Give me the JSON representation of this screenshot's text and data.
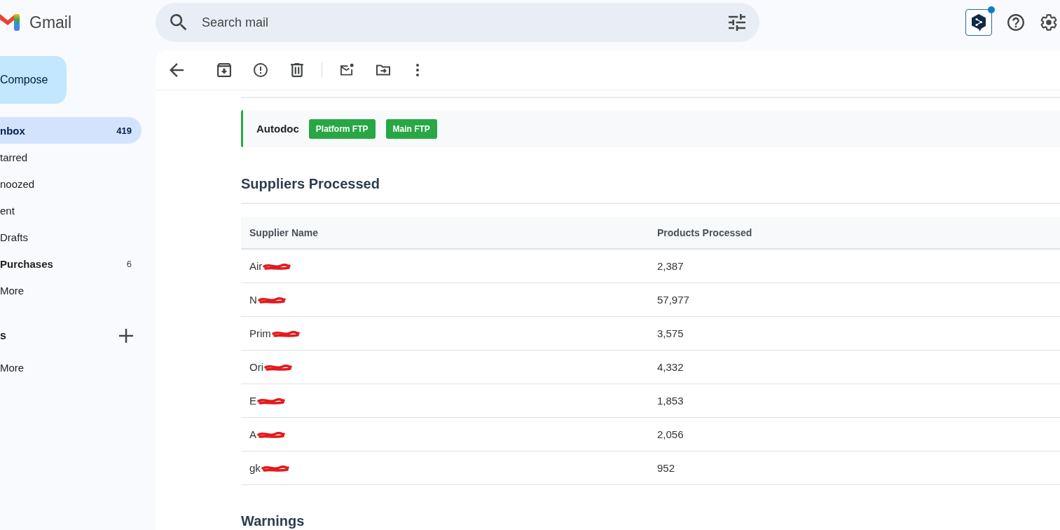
{
  "header": {
    "app_name": "Gmail",
    "search": {
      "placeholder": "Search mail"
    },
    "extension": {
      "notification": true
    }
  },
  "sidebar": {
    "compose": "Compose",
    "items": [
      {
        "label": "nbox",
        "count": "419",
        "unread": true,
        "selected": true
      },
      {
        "label": "tarred",
        "unread": false,
        "selected": false
      },
      {
        "label": "noozed",
        "unread": false,
        "selected": false
      },
      {
        "label": "ent",
        "unread": false,
        "selected": false
      },
      {
        "label": "Drafts",
        "unread": false,
        "selected": false
      },
      {
        "label": "Purchases",
        "count": "6",
        "unread": true,
        "selected": false
      },
      {
        "label": "More",
        "unread": false,
        "selected": false
      }
    ],
    "labels": {
      "title": "s",
      "items": [
        {
          "label": "More",
          "selected": false
        }
      ]
    }
  },
  "message": {
    "source": {
      "name": "Autodoc",
      "tags": [
        "Platform FTP",
        "Main FTP"
      ]
    },
    "sections": [
      {
        "heading": "Suppliers Processed",
        "table": {
          "columns": [
            "Supplier Name",
            "Products Processed"
          ],
          "rows": [
            {
              "supplier": "Air",
              "products": "2,387",
              "redacted": true
            },
            {
              "supplier": "N",
              "products": "57,977",
              "redacted": true
            },
            {
              "supplier": "Prim",
              "products": "3,575",
              "redacted": true
            },
            {
              "supplier": "Ori",
              "products": "4,332",
              "redacted": true
            },
            {
              "supplier": "E",
              "products": "1,853",
              "redacted": true
            },
            {
              "supplier": "A",
              "products": "2,056",
              "redacted": true
            },
            {
              "supplier": "gk",
              "products": "952",
              "redacted": true
            }
          ]
        }
      },
      {
        "heading": "Warnings"
      }
    ]
  }
}
